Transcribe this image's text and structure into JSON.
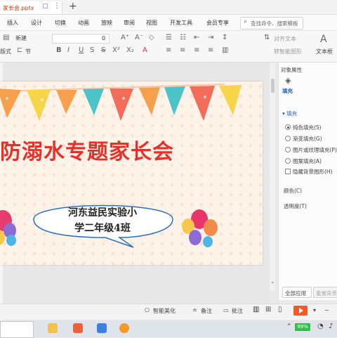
{
  "titlebar": {
    "tab_title": "家长会.pptx",
    "new_tab": "+"
  },
  "menu": {
    "items": [
      "插入",
      "设计",
      "切换",
      "动画",
      "放映",
      "审阅",
      "视图",
      "开发工具",
      "会员专享"
    ],
    "search_placeholder": "查找命令、搜索模板"
  },
  "ribbon": {
    "new_slide": "新建",
    "layout": "版式",
    "section": "节",
    "font_size": "0",
    "shape_fill_label": "对齐文本",
    "text_box": "文本框",
    "smart_art": "转智能图形"
  },
  "slide": {
    "title": "防溺水专题家长会",
    "bubble_line1": "河东益民实验小",
    "bubble_line2": "学二年级4班"
  },
  "panel": {
    "header": "对象属性",
    "tab_fill": "填充",
    "section_fill": "▾ 填充",
    "options": [
      "纯色填充(S)",
      "渐变填充(G)",
      "图片或纹理填充(P)",
      "图案填充(A)"
    ],
    "hide_bg": "隐藏背景图形(H)",
    "color_label": "颜色(C)",
    "transparency_label": "透明度(T)",
    "apply_all": "全部应用",
    "reset_bg": "重置背景"
  },
  "statusbar": {
    "smart_beautify": "智能美化",
    "notes": "备注",
    "comments": "批注"
  },
  "system": {
    "battery": "99%"
  },
  "colors": {
    "title_red": "#e6312a",
    "accent_orange": "#f05a28",
    "flag_orange": "#f6a04d",
    "flag_teal": "#4cc3c6",
    "flag_yellow": "#f7d54a",
    "flag_red": "#f26c5a"
  }
}
